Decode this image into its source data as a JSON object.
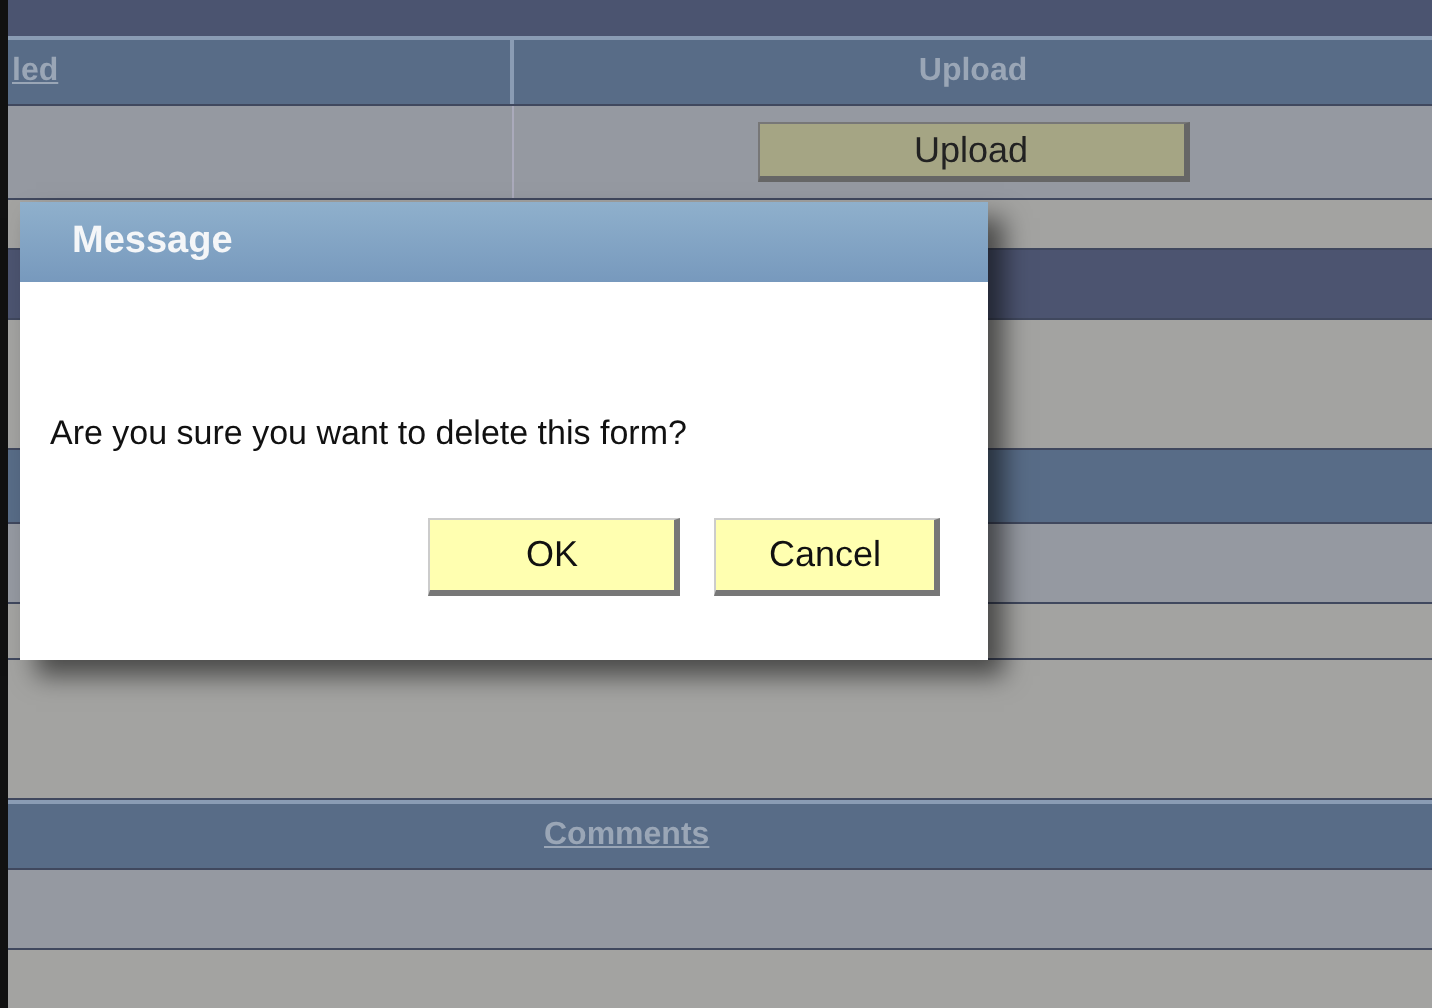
{
  "table": {
    "columns": [
      {
        "label": "led",
        "kind": "link"
      },
      {
        "label": "Upload",
        "kind": "text"
      }
    ],
    "upload_button": "Upload",
    "comments_header": "Comments"
  },
  "dialog": {
    "title": "Message",
    "message": "Are you sure you want to delete this form?",
    "buttons": [
      {
        "label": "OK"
      },
      {
        "label": "Cancel"
      }
    ]
  }
}
